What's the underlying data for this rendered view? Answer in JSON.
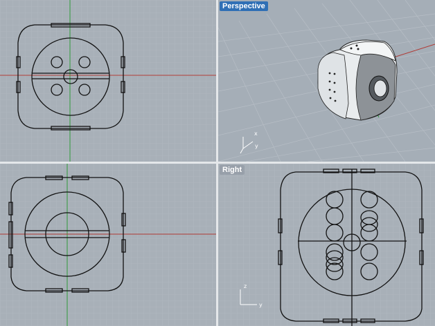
{
  "viewports": {
    "top": {
      "label": ""
    },
    "perspective": {
      "label": "Perspective",
      "active": true
    },
    "front": {
      "label": ""
    },
    "right": {
      "label": "Right"
    }
  },
  "axes": {
    "perspective": {
      "x": "x",
      "y": "y"
    },
    "right": {
      "z": "z",
      "y": "y"
    }
  },
  "colors": {
    "grid_minor": "#b4bbc3",
    "grid_major": "#9ca4ad",
    "x_axis": "#b03a35",
    "y_axis": "#2f9a3a",
    "geometry": "#111111",
    "active_label": "#2f6fb5"
  }
}
